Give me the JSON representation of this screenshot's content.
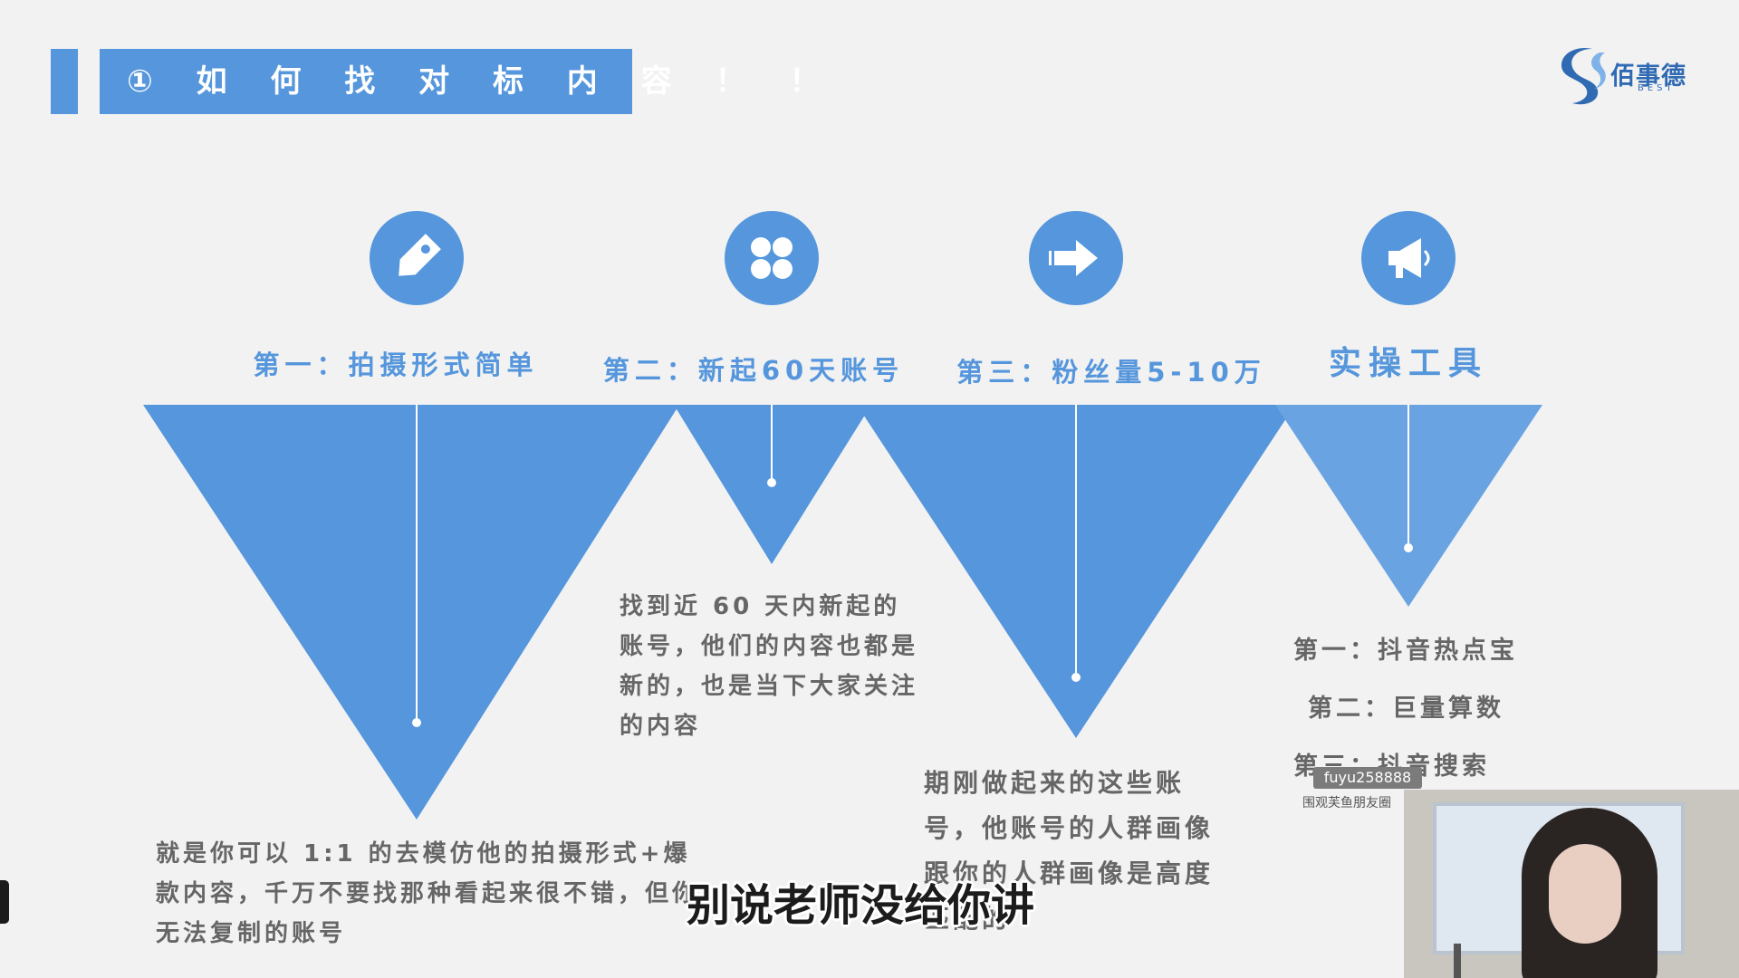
{
  "slide": {
    "title": "① 如 何 找 对 标 内 容 ！ ！",
    "logo": {
      "brand": "佰事德",
      "sub": "BEST"
    },
    "accent_color": "#5596dc",
    "columns": [
      {
        "icon": "tag-icon",
        "heading": "第一：拍摄形式简单",
        "body": "就是你可以 1:1 的去模仿他的拍摄形式+爆款内容，千万不要找那种看起来很不错，但你无法复制的账号"
      },
      {
        "icon": "grid-icon",
        "heading": "第二：新起60天账号",
        "body": "找到近 60 天内新起的账号，他们的内容也都是新的，也是当下大家关注的内容"
      },
      {
        "icon": "arrow-right-icon",
        "heading": "第三：粉丝量5-10万",
        "body": "期刚做起来的这些账号，他账号的人群画像跟你的人群画像是高度匹配的"
      },
      {
        "icon": "megaphone-icon",
        "heading": "实操工具",
        "tools": [
          "第一：抖音热点宝",
          "第二：巨量算数",
          "第三：抖音搜索"
        ]
      }
    ]
  },
  "overlay": {
    "watermark_id": "fuyu258888",
    "watermark_caption": "围观芙鱼朋友圈",
    "subtitle": "别说老师没给你讲"
  }
}
